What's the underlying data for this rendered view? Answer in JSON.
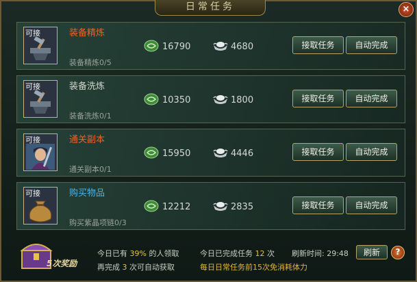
{
  "window": {
    "title": "日常任务",
    "close_symbol": "×"
  },
  "colors": {
    "name_highlight": "#e8642a",
    "name_normal": "#d2d7ce",
    "name_blue": "#4fb3e6"
  },
  "tasks": [
    {
      "status": "可接",
      "name": "装备精炼",
      "name_color": "#e8642a",
      "progress": "装备精炼0/5",
      "coin": "16790",
      "silver": "4680",
      "accept_label": "接取任务",
      "auto_label": "自动完成",
      "icon": "anvil-icon"
    },
    {
      "status": "可接",
      "name": "装备洗炼",
      "name_color": "#d2d7ce",
      "progress": "装备洗炼0/1",
      "coin": "10350",
      "silver": "1800",
      "accept_label": "接取任务",
      "auto_label": "自动完成",
      "icon": "anvil-icon"
    },
    {
      "status": "可接",
      "name": "通关副本",
      "name_color": "#e8642a",
      "progress": "通关副本0/1",
      "coin": "15950",
      "silver": "4446",
      "accept_label": "接取任务",
      "auto_label": "自动完成",
      "icon": "warrior-portrait-icon"
    },
    {
      "status": "可接",
      "name": "购买物品",
      "name_color": "#4fb3e6",
      "progress": "购买紫晶项链0/3",
      "coin": "12212",
      "silver": "2835",
      "accept_label": "接取任务",
      "auto_label": "自动完成",
      "icon": "money-bag-icon"
    }
  ],
  "footer": {
    "chest_label": "5次奖励",
    "claimed_pre": "今日已有",
    "claimed_pct": "39%",
    "claimed_post": "的人领取",
    "remaining_pre": "再完成",
    "remaining_count": "3",
    "remaining_post": "次可自动获取",
    "done_pre": "今日已完成任务",
    "done_count": "12",
    "done_post": "次",
    "refresh_time_label": "刷新时间:",
    "refresh_time": "29:48",
    "refresh_button": "刷新",
    "help_symbol": "?",
    "free_note": "每日日常任务前15次免消耗体力"
  }
}
